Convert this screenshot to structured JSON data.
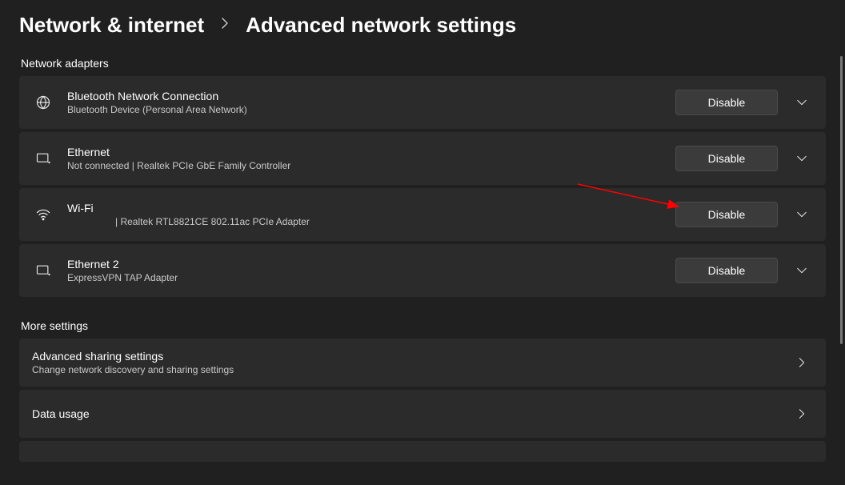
{
  "breadcrumb": {
    "parent": "Network & internet",
    "current": "Advanced network settings"
  },
  "sections": {
    "adapters_title": "Network adapters",
    "more_title": "More settings"
  },
  "adapters": [
    {
      "title": "Bluetooth Network Connection",
      "subtitle": "Bluetooth Device (Personal Area Network)",
      "button": "Disable",
      "icon": "globe"
    },
    {
      "title": "Ethernet",
      "subtitle": "Not connected | Realtek PCIe GbE Family Controller",
      "button": "Disable",
      "icon": "monitor"
    },
    {
      "title": "Wi-Fi",
      "subtitle": " | Realtek RTL8821CE 802.11ac PCIe Adapter",
      "button": "Disable",
      "icon": "wifi"
    },
    {
      "title": "Ethernet 2",
      "subtitle": "ExpressVPN TAP Adapter",
      "button": "Disable",
      "icon": "monitor"
    }
  ],
  "more": [
    {
      "title": "Advanced sharing settings",
      "subtitle": "Change network discovery and sharing settings"
    },
    {
      "title": "Data usage",
      "subtitle": ""
    }
  ],
  "annotation": {
    "type": "arrow",
    "color": "#ff0000"
  }
}
